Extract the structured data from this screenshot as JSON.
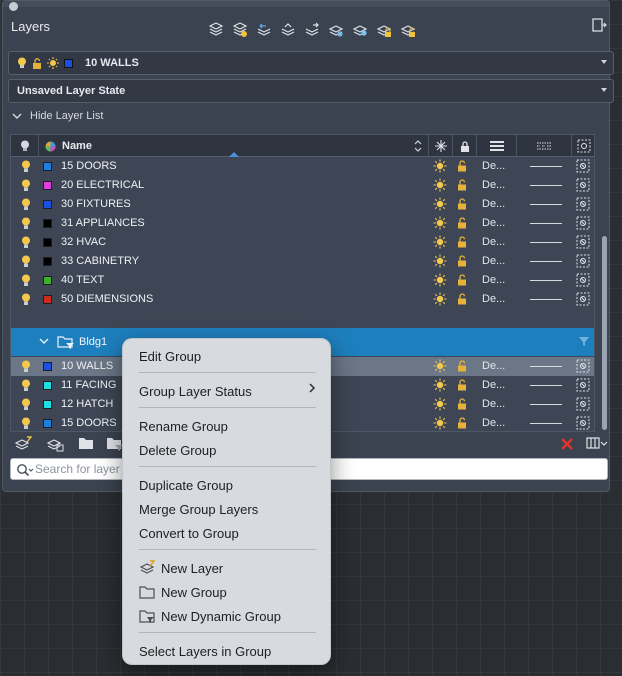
{
  "palette": {
    "title": "Layers"
  },
  "current_layer": {
    "name": "10 WALLS",
    "color": "#1b4fe0"
  },
  "layer_state": {
    "value": "Unsaved Layer State"
  },
  "hide_list": {
    "label": "Hide Layer List"
  },
  "columns": {
    "name": "Name"
  },
  "layers": [
    {
      "name": "15 DOORS",
      "color": "#1b7fe0",
      "linetype": "De..."
    },
    {
      "name": "20 ELECTRICAL",
      "color": "#e03ce0",
      "linetype": "De..."
    },
    {
      "name": "30 FIXTURES",
      "color": "#1b4fe0",
      "linetype": "De..."
    },
    {
      "name": "31 APPLIANCES",
      "color": "#000000",
      "linetype": "De..."
    },
    {
      "name": "32 HVAC",
      "color": "#000000",
      "linetype": "De..."
    },
    {
      "name": "33 CABINETRY",
      "color": "#000000",
      "linetype": "De..."
    },
    {
      "name": "40 TEXT",
      "color": "#3fae2a",
      "linetype": "De..."
    },
    {
      "name": "50 DIEMENSIONS",
      "color": "#d02a1e",
      "linetype": "De..."
    }
  ],
  "group": {
    "name": "Bldg1"
  },
  "group_layers": [
    {
      "name": "10 WALLS",
      "color": "#1b4fe0",
      "linetype": "De...",
      "selected": true
    },
    {
      "name": "11 FACING",
      "color": "#1ee0e0",
      "linetype": "De..."
    },
    {
      "name": "12 HATCH",
      "color": "#1ee0e0",
      "linetype": "De..."
    },
    {
      "name": "15 DOORS",
      "color": "#1b7fe0",
      "linetype": "De..."
    }
  ],
  "search": {
    "placeholder": "Search for layer"
  },
  "context_menu": {
    "edit_group": "Edit Group",
    "group_layer_status": "Group Layer Status",
    "rename_group": "Rename Group",
    "delete_group": "Delete Group",
    "duplicate_group": "Duplicate Group",
    "merge_group_layers": "Merge Group Layers",
    "convert_to_group": "Convert to Group",
    "new_layer": "New Layer",
    "new_group": "New Group",
    "new_dynamic_group": "New Dynamic Group",
    "select_layers_in_group": "Select Layers in Group"
  },
  "icons": {
    "bulb": "lightbulb-on-icon",
    "sun": "thawed-sun-icon",
    "lock": "unlocked-padlock-icon",
    "viewport": "viewport-freeze-icon"
  },
  "colors": {
    "selection_blue": "#1e7fbe",
    "delete_red": "#e0352e"
  }
}
